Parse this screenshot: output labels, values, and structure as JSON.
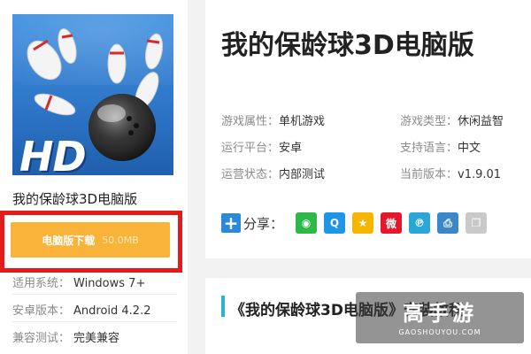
{
  "left": {
    "app_name": "我的保龄球3D电脑版",
    "download": {
      "label": "电脑版下载",
      "size": "50.0MB"
    },
    "specs": [
      {
        "key": "适用系统：",
        "value": "Windows 7+"
      },
      {
        "key": "安卓版本：",
        "value": "Android 4.2.2"
      },
      {
        "key": "兼容测试：",
        "value": "完美兼容"
      }
    ],
    "icon_badge": "HD"
  },
  "main": {
    "title": "我的保龄球3D电脑版",
    "attributes": [
      {
        "key": "游戏属性：",
        "value": "单机游戏"
      },
      {
        "key": "游戏类型：",
        "value": "休闲益智"
      },
      {
        "key": "运行平台：",
        "value": "安卓"
      },
      {
        "key": "支持语言：",
        "value": "中文"
      },
      {
        "key": "运营状态：",
        "value": "内部测试"
      },
      {
        "key": "当前版本：",
        "value": "v1.9.01"
      }
    ],
    "share": {
      "label": "分享：",
      "icons": [
        {
          "name": "wechat-icon",
          "color": "#2fb84a",
          "glyph": "◉"
        },
        {
          "name": "qq-icon",
          "color": "#1d96e8",
          "glyph": "Q"
        },
        {
          "name": "qzone-icon",
          "color": "#f7b500",
          "glyph": "★"
        },
        {
          "name": "weibo-icon",
          "color": "#e6162d",
          "glyph": "微"
        },
        {
          "name": "tencent-weibo-icon",
          "color": "#2aa6d8",
          "glyph": "℗"
        },
        {
          "name": "print-icon",
          "color": "#3c87c9",
          "glyph": "⎙"
        },
        {
          "name": "copy-icon",
          "color": "#c9c9c9",
          "glyph": "❐"
        }
      ]
    }
  },
  "section": {
    "title": "《我的保龄球3D电脑版》安装教程"
  },
  "watermark": {
    "main": "高手游",
    "sub": "GAOSHOUYOU.COM"
  },
  "colors": {
    "download_button": "#f9b339",
    "highlight_border": "#e31b1b",
    "section_accent": "#28b6c8",
    "share_plus": "#2a89d8"
  }
}
